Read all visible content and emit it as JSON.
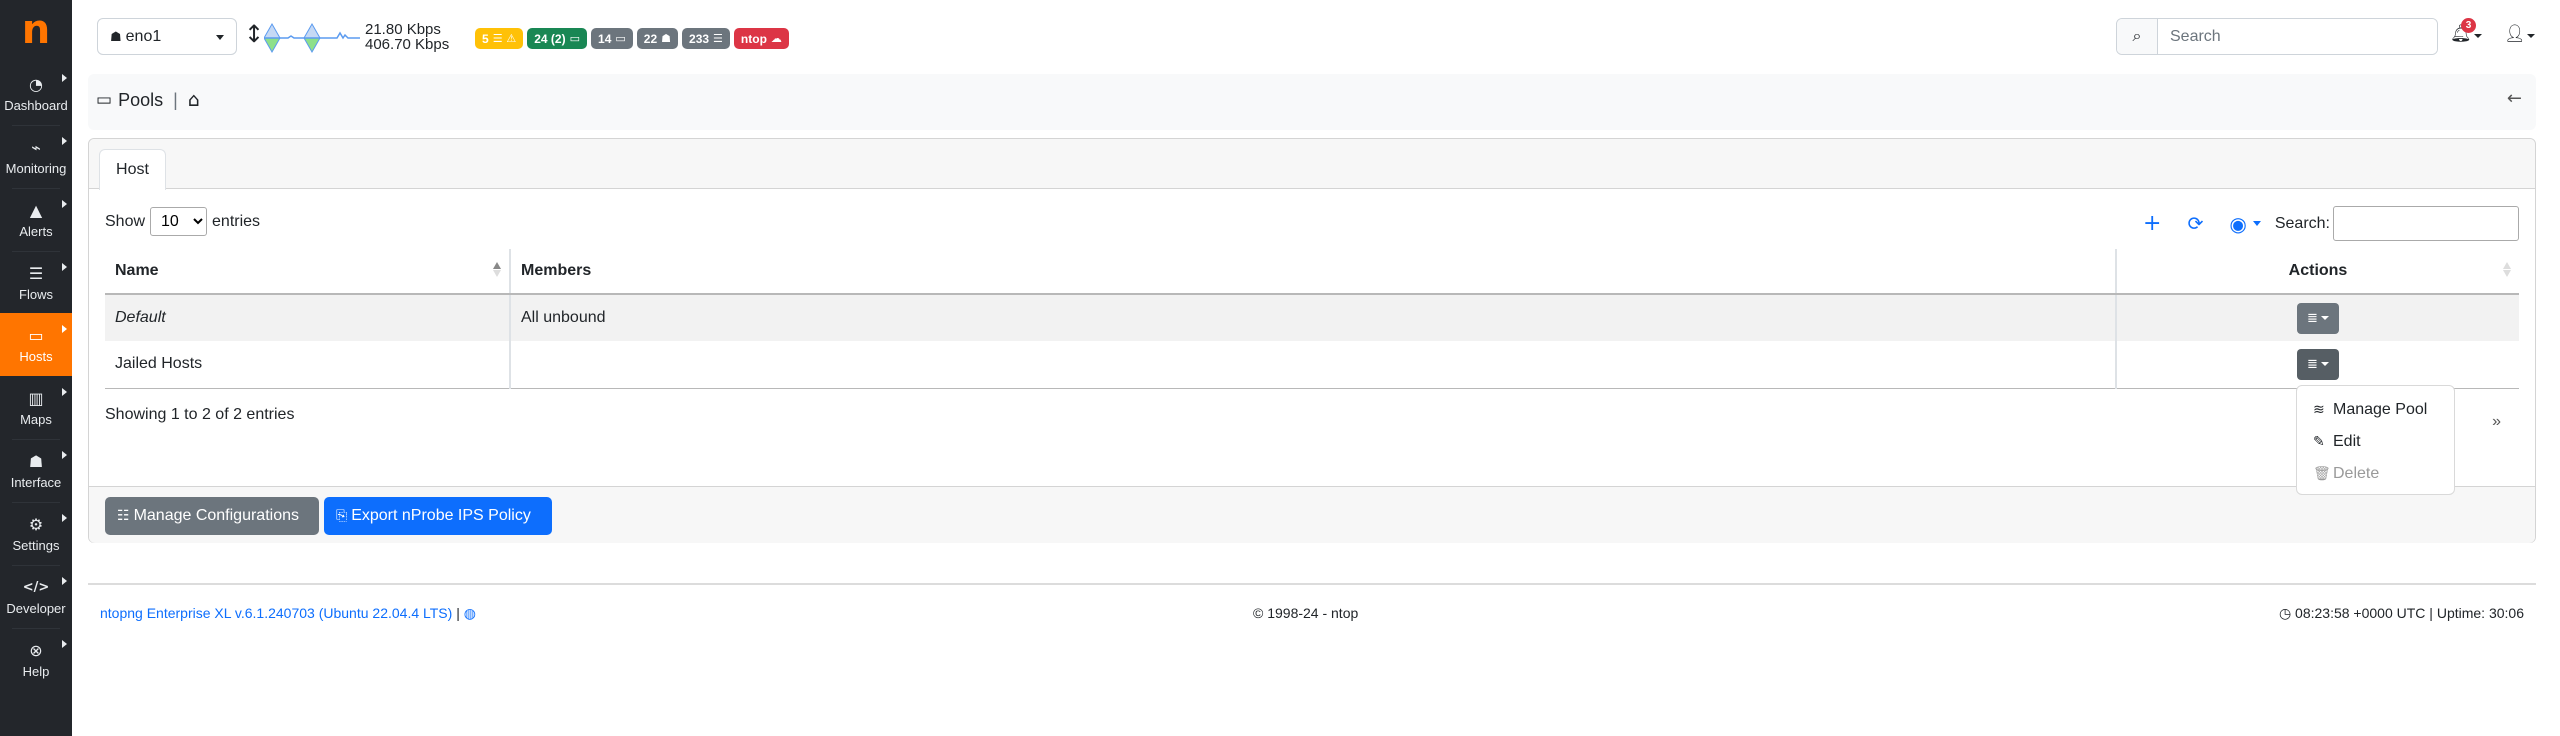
{
  "sidebar": {
    "logo": "n",
    "items": [
      {
        "label": "Dashboard",
        "icon": "gauge-icon",
        "glyph": "◔",
        "active": false
      },
      {
        "label": "Monitoring",
        "icon": "satellite-dish-icon",
        "glyph": "📡",
        "active": false
      },
      {
        "label": "Alerts",
        "icon": "warning-icon",
        "glyph": "▲",
        "active": false
      },
      {
        "label": "Flows",
        "icon": "bars-icon",
        "glyph": "☰",
        "active": false
      },
      {
        "label": "Hosts",
        "icon": "laptop-icon",
        "glyph": "▭",
        "active": true
      },
      {
        "label": "Maps",
        "icon": "map-icon",
        "glyph": "▥",
        "active": false
      },
      {
        "label": "Interface",
        "icon": "ethernet-icon",
        "glyph": "☗",
        "active": false
      },
      {
        "label": "Settings",
        "icon": "cog-icon",
        "glyph": "⚙",
        "active": false
      },
      {
        "label": "Developer",
        "icon": "code-icon",
        "glyph": "</>",
        "active": false
      },
      {
        "label": "Help",
        "icon": "life-ring-icon",
        "glyph": "⊗",
        "active": false
      }
    ]
  },
  "navbar": {
    "interface": "eno1",
    "traffic_up": "21.80 Kbps",
    "traffic_down": "406.70 Kbps",
    "badges": [
      {
        "text": "5",
        "icons": "☰ ⚠",
        "color": "#ffc107",
        "meaning": "flow-alerts"
      },
      {
        "text": "24 (2)",
        "icons": "▭",
        "color": "#198754",
        "meaning": "local-hosts"
      },
      {
        "text": "14",
        "icons": "▭",
        "color": "#6c757d",
        "meaning": "remote-hosts"
      },
      {
        "text": "22",
        "icons": "☗",
        "color": "#6c757d",
        "meaning": "devices"
      },
      {
        "text": "233",
        "icons": "☰",
        "color": "#6c757d",
        "meaning": "flows"
      },
      {
        "text": "ntop",
        "icons": "☁",
        "color": "#dc3545",
        "meaning": "cloud"
      }
    ],
    "search_placeholder": "Search",
    "notifications_count": "3"
  },
  "breadcrumb": {
    "title": "Pools",
    "back_icon": "←"
  },
  "tabs": [
    {
      "label": "Host",
      "active": true
    }
  ],
  "table_controls": {
    "show_label": "Show",
    "entries_label": "entries",
    "page_size": "10",
    "search_label": "Search:",
    "search_value": ""
  },
  "table": {
    "columns": [
      "Name",
      "Members",
      "Actions"
    ],
    "rows": [
      {
        "name": "Default",
        "members": "All unbound",
        "italic": true
      },
      {
        "name": "Jailed Hosts",
        "members": "",
        "italic": false
      }
    ],
    "info": "Showing 1 to 2 of 2 entries",
    "next": "»"
  },
  "row_menu": {
    "items": [
      {
        "label": "Manage Pool",
        "icon": "layer-group-icon",
        "enabled": true
      },
      {
        "label": "Edit",
        "icon": "edit-icon",
        "enabled": true
      },
      {
        "label": "Delete",
        "icon": "trash-icon",
        "enabled": false
      }
    ]
  },
  "actions": {
    "manage_configs": "Manage Configurations",
    "export_policy": "Export nProbe IPS Policy"
  },
  "footer": {
    "version": "ntopng Enterprise XL v.6.1.240703 (Ubuntu 22.04.4 LTS)",
    "copyright": "© 1998-24 - ntop",
    "clock": "08:23:58 +0000 UTC | Uptime: 30:06"
  },
  "colors": {
    "accent": "#ff7500",
    "primary": "#0d6efd",
    "sidebar_bg": "#23262b"
  }
}
